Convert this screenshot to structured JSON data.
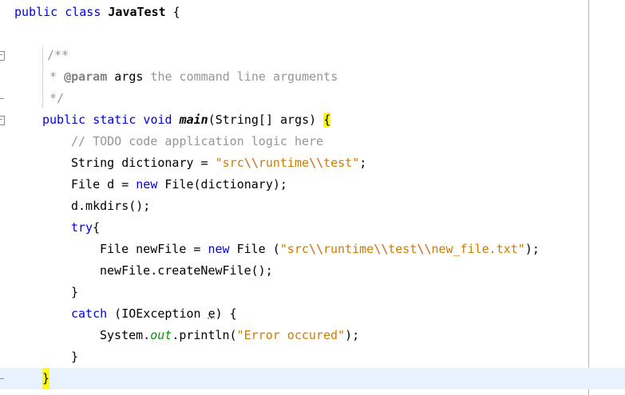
{
  "editor": {
    "lines": [
      {
        "segments": [
          {
            "t": "public class "
          },
          {
            "t": "JavaTest"
          },
          {
            "t": " {"
          }
        ]
      },
      {
        "segments": [
          {
            "t": "/**"
          }
        ]
      },
      {
        "segments": [
          {
            "t": "* "
          },
          {
            "t": "@param"
          },
          {
            "t": " args "
          },
          {
            "t": "the command line arguments"
          }
        ]
      },
      {
        "segments": [
          {
            "t": "*/"
          }
        ]
      },
      {
        "segments": [
          {
            "t": "public static void "
          },
          {
            "t": "main"
          },
          {
            "t": "(String[] args) "
          },
          {
            "t": "{"
          }
        ]
      },
      {
        "segments": [
          {
            "t": "// TODO code application logic here"
          }
        ]
      },
      {
        "segments": [
          {
            "t": "String dictionary = "
          },
          {
            "t": "\"src"
          },
          {
            "t": "\\\\"
          },
          {
            "t": "runtime"
          },
          {
            "t": "\\\\"
          },
          {
            "t": "test\""
          },
          {
            "t": ";"
          }
        ]
      },
      {
        "segments": [
          {
            "t": "File d = "
          },
          {
            "t": "new"
          },
          {
            "t": " File(dictionary);"
          }
        ]
      },
      {
        "segments": [
          {
            "t": "d.mkdirs();"
          }
        ]
      },
      {
        "segments": [
          {
            "t": "try"
          },
          {
            "t": "{"
          }
        ]
      },
      {
        "segments": [
          {
            "t": "File newFile = "
          },
          {
            "t": "new"
          },
          {
            "t": " File ("
          },
          {
            "t": "\"src"
          },
          {
            "t": "\\\\"
          },
          {
            "t": "runtime"
          },
          {
            "t": "\\\\"
          },
          {
            "t": "test"
          },
          {
            "t": "\\\\"
          },
          {
            "t": "new_file.txt\""
          },
          {
            "t": ");"
          }
        ]
      },
      {
        "segments": [
          {
            "t": "newFile.createNewFile();"
          }
        ]
      },
      {
        "segments": [
          {
            "t": "}"
          }
        ]
      },
      {
        "segments": [
          {
            "t": "catch"
          },
          {
            "t": " (IOException "
          },
          {
            "t": "e"
          },
          {
            "t": ") {"
          }
        ]
      },
      {
        "segments": [
          {
            "t": "System."
          },
          {
            "t": "out"
          },
          {
            "t": ".println("
          },
          {
            "t": "\"Error occured\""
          },
          {
            "t": ");"
          }
        ]
      },
      {
        "segments": [
          {
            "t": "}"
          }
        ]
      },
      {
        "segments": [
          {
            "t": "}"
          }
        ]
      }
    ]
  },
  "colors": {
    "keyword": "#0000e6",
    "string": "#ce7b00",
    "comment": "#969696",
    "current_line": "#e8f2fe",
    "brace_match": "#ffff00",
    "margin_line": "#f0a0a0"
  }
}
